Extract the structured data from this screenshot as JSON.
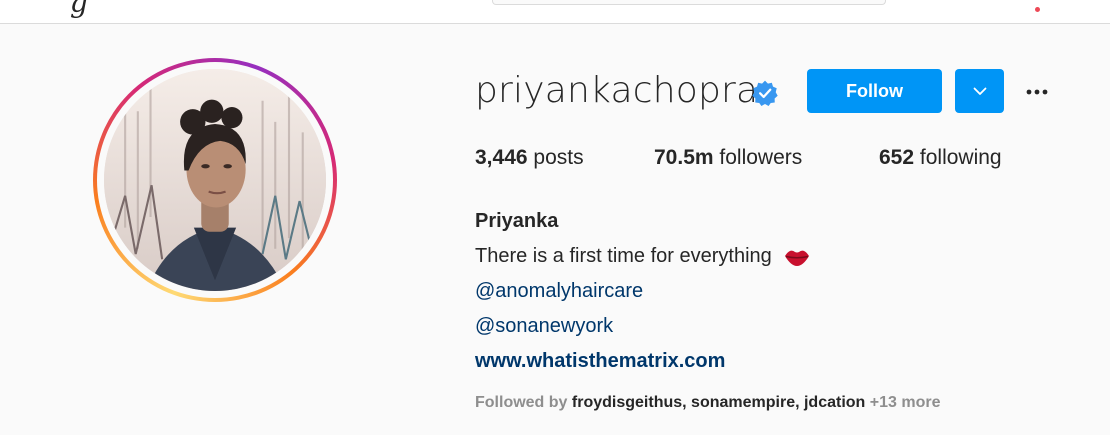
{
  "profile": {
    "username": "priyankachopra",
    "follow_label": "Follow",
    "stats": {
      "posts_count": "3,446",
      "posts_label": "posts",
      "followers_count": "70.5m",
      "followers_label": "followers",
      "following_count": "652",
      "following_label": "following"
    },
    "bio": {
      "name": "Priyanka",
      "tagline": "There is a first time for everything",
      "mention_1": "@anomalyhaircare",
      "mention_2": "@sonanewyork",
      "website": "www.whatisthematrix.com"
    },
    "followed_by": {
      "prefix": "Followed by",
      "user_1": "froydisgeithus,",
      "user_2": "sonamempire,",
      "user_3": "jdcation",
      "more": "+13 more"
    }
  },
  "icons": {
    "verified": "verified-badge-icon",
    "dropdown": "chevron-down-icon",
    "more": "more-options-icon",
    "lips": "lips-emoji-icon"
  },
  "colors": {
    "accent": "#0095f6",
    "verified": "#3897f0",
    "link": "#00376b",
    "muted": "#8e8e8e",
    "text": "#262626"
  }
}
